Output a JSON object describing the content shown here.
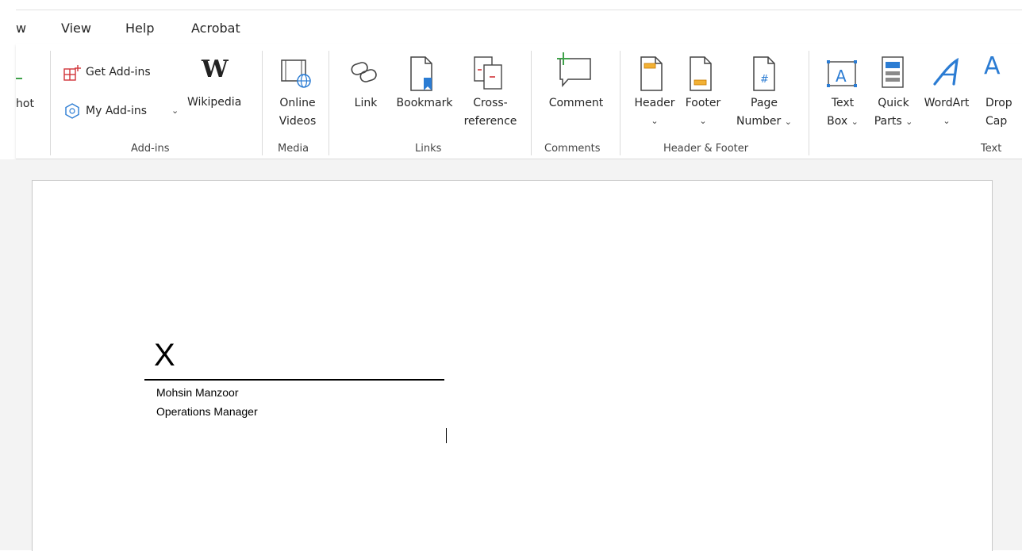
{
  "tabs": {
    "partial": "w",
    "view": "View",
    "help": "Help",
    "acrobat": "Acrobat"
  },
  "ribbon": {
    "screenshot_partial": "hot",
    "addins": {
      "get_addins": "Get Add-ins",
      "my_addins": "My Add-ins",
      "wikipedia": "Wikipedia",
      "group_label": "Add-ins"
    },
    "media": {
      "online_videos_line1": "Online",
      "online_videos_line2": "Videos",
      "group_label": "Media"
    },
    "links": {
      "link": "Link",
      "bookmark": "Bookmark",
      "cross_ref_line1": "Cross-",
      "cross_ref_line2": "reference",
      "group_label": "Links"
    },
    "comments": {
      "comment": "Comment",
      "group_label": "Comments"
    },
    "header_footer": {
      "header": "Header",
      "footer": "Footer",
      "page_number_line1": "Page",
      "page_number_line2": "Number",
      "group_label": "Header & Footer"
    },
    "text": {
      "text_box_line1": "Text",
      "text_box_line2": "Box",
      "quick_parts_line1": "Quick",
      "quick_parts_line2": "Parts",
      "wordart": "WordArt",
      "drop_cap_line1": "Drop",
      "drop_cap_line2": "Cap",
      "group_label": "Text"
    },
    "chevron": "⌄"
  },
  "document": {
    "signature_x": "X",
    "signer_name": "Mohsin Manzoor",
    "signer_title": "Operations Manager"
  },
  "colors": {
    "accent_blue": "#2b7cd3",
    "addin_red": "#d13438",
    "comment_green": "#3fa14a",
    "header_orange": "#f2b134"
  }
}
